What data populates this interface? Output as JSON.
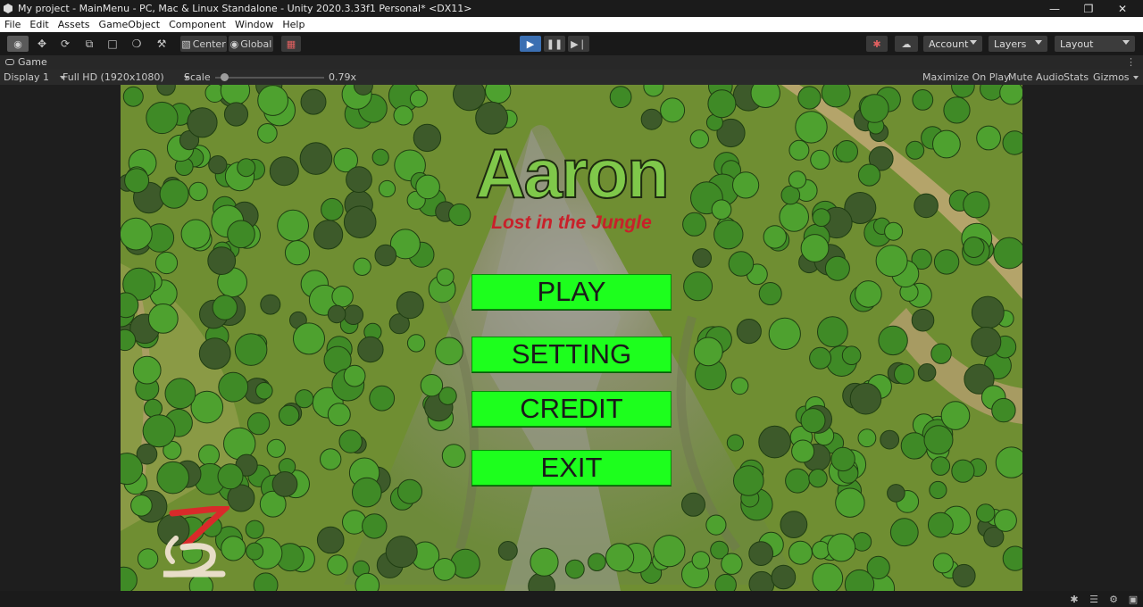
{
  "window": {
    "title": "My project - MainMenu - PC, Mac & Linux Standalone - Unity 2020.3.33f1 Personal* <DX11>",
    "controls": [
      "minimize-icon",
      "maximize-icon",
      "close-icon"
    ]
  },
  "menubar": {
    "items": [
      "File",
      "Edit",
      "Assets",
      "GameObject",
      "Component",
      "Window",
      "Help"
    ]
  },
  "toolbar": {
    "tools": [
      "view-tool-icon",
      "move-tool-icon",
      "rotate-tool-icon",
      "scale-tool-icon",
      "rect-tool-icon",
      "transform-tool-icon",
      "custom-tool-icon"
    ],
    "pivot_label": "Center",
    "space_label": "Global",
    "play_controls": [
      "play-icon",
      "pause-icon",
      "step-icon"
    ],
    "account_label": "Account",
    "layers_label": "Layers",
    "layout_label": "Layout"
  },
  "game_view": {
    "tab_label": "Game",
    "display_label": "Display 1",
    "resolution_label": "Full HD (1920x1080)",
    "scale_label": "Scale",
    "scale_value": "0.79x",
    "scale_fraction": 0.07,
    "maximize_label": "Maximize On Play",
    "mute_label": "Mute Audio",
    "stats_label": "Stats",
    "gizmos_label": "Gizmos"
  },
  "game": {
    "title": "Aaron",
    "subtitle": "Lost in the Jungle",
    "buttons": {
      "play": "PLAY",
      "setting": "SETTING",
      "credit": "CREDIT",
      "exit": "EXIT"
    },
    "colors": {
      "title": "#7fc84a",
      "subtitle": "#c8202a",
      "button": "#1dff1d"
    }
  }
}
